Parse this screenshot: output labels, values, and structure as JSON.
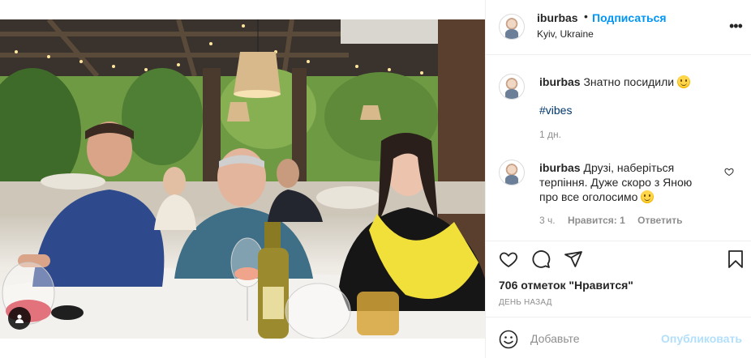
{
  "post": {
    "author": {
      "username": "iburbas",
      "separator": "•",
      "follow_label": "Подписаться",
      "location": "Kyiv, Ukraine",
      "more_icon": "more-horizontal-icon",
      "more_label": "•••"
    },
    "caption": {
      "username": "iburbas",
      "text": "Знатно посидили",
      "emoji_icon": "slightly-smiling-face-icon",
      "hashtag": "#vibes",
      "time": "1 дн."
    },
    "comments": [
      {
        "username": "iburbas",
        "text_line1": "Друзі, наберіться",
        "text_line2": "терпіння. Дуже скоро з Яною",
        "text_line3": "про все оголосимо",
        "emoji_icon": "winking-face-icon",
        "time": "3 ч.",
        "likes_label": "Нравится: 1",
        "reply_label": "Ответить"
      }
    ],
    "actions": {
      "like_icon": "heart-icon",
      "comment_icon": "comment-icon",
      "share_icon": "send-icon",
      "save_icon": "bookmark-icon"
    },
    "likes_text": "706 отметок \"Нравится\"",
    "date_text": "ДЕНЬ НАЗАД",
    "composer": {
      "emoji_icon": "smiley-icon",
      "placeholder": "Добавьте",
      "publish_label": "Опубликовать"
    },
    "photo_tag_icon": "user-tag-icon"
  },
  "colors": {
    "link_blue": "#0095f6",
    "publish_disabled": "#b2dffc",
    "hashtag": "#00376b",
    "meta_gray": "#8e8e8e",
    "text": "#262626",
    "border": "#efefef"
  }
}
